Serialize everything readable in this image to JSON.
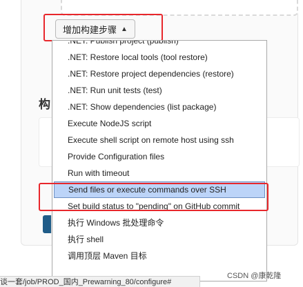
{
  "toolbar": {
    "add_build_step_label": "增加构建步骤",
    "caret_icon": "▲"
  },
  "section": {
    "partial_heading": "构"
  },
  "dropdown": {
    "items": [
      ".NET: Publish project (publish)",
      ".NET: Restore local tools (tool restore)",
      ".NET: Restore project dependencies (restore)",
      ".NET: Run unit tests (test)",
      ".NET: Show dependencies (list package)",
      "Execute NodeJS script",
      "Execute shell script on remote host using ssh",
      "Provide Configuration files",
      "Run with timeout",
      "Send files or execute commands over SSH",
      "Set build status to \"pending\" on GitHub commit",
      "执行 Windows 批处理命令",
      "执行 shell",
      "调用顶层 Maven 目标"
    ],
    "selected_index": 9
  },
  "status_bar": {
    "url_text": "谈一套/job/PROD_国内_Prewarning_80/configure#"
  },
  "watermark": {
    "text": "CSDN @康乾隆"
  },
  "colors": {
    "highlight_red": "#e8262b",
    "selected_bg": "#bcd4f8",
    "primary_blue": "#1f5c88"
  }
}
